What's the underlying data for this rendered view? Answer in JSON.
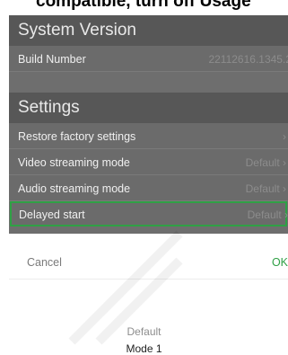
{
  "caption": "compatible, turn off Usage",
  "sections": {
    "system_version": {
      "title": "System Version",
      "build_number_label": "Build Number",
      "build_number_value": "22112616.1345.2"
    },
    "settings": {
      "title": "Settings",
      "restore_label": "Restore factory settings",
      "video_label": "Video streaming mode",
      "video_value": "Default",
      "audio_label": "Audio streaming mode",
      "audio_value": "Default",
      "delayed_label": "Delayed start",
      "delayed_value": "Default"
    }
  },
  "picker": {
    "cancel": "Cancel",
    "ok": "OK",
    "options": [
      "Default",
      "Mode 1"
    ]
  },
  "colors": {
    "highlight": "#2fa045",
    "ok": "#2fa045",
    "dim_panel": "#6e6e6e"
  }
}
